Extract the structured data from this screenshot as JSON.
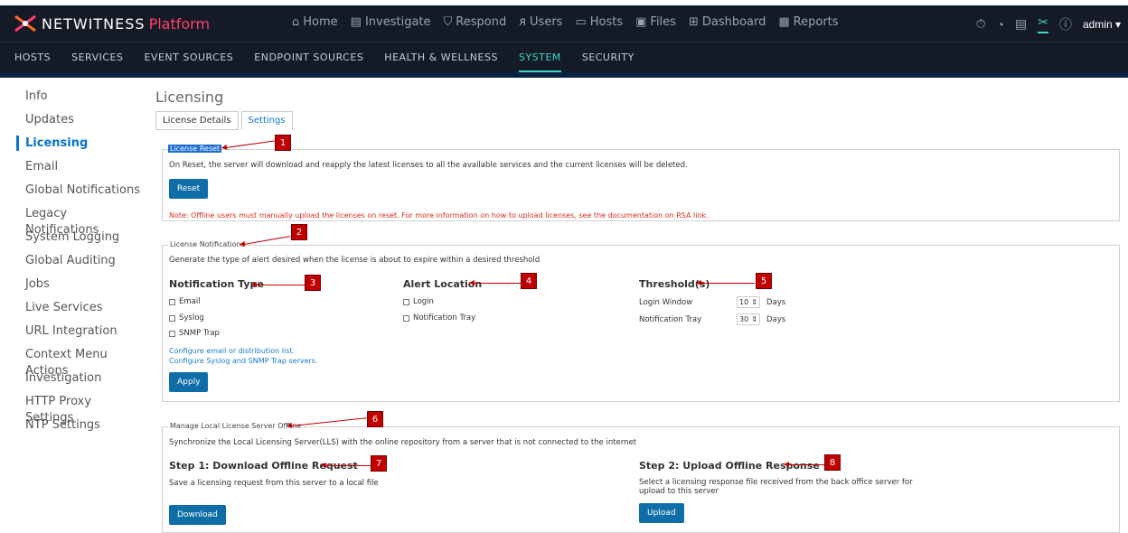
{
  "brand": {
    "name": "NETWITNESS",
    "product": "Platform"
  },
  "main_nav": [
    {
      "icon": "home-icon",
      "glyph": "⌂",
      "label": "Home"
    },
    {
      "icon": "investigate-icon",
      "glyph": "▤",
      "label": "Investigate"
    },
    {
      "icon": "respond-icon",
      "glyph": "⛉",
      "label": "Respond"
    },
    {
      "icon": "users-icon",
      "glyph": "ᴙ",
      "label": "Users"
    },
    {
      "icon": "hosts-icon",
      "glyph": "▭",
      "label": "Hosts"
    },
    {
      "icon": "files-icon",
      "glyph": "▣",
      "label": "Files"
    },
    {
      "icon": "dashboard-icon",
      "glyph": "⊞",
      "label": "Dashboard"
    },
    {
      "icon": "reports-icon",
      "glyph": "▦",
      "label": "Reports"
    }
  ],
  "user": {
    "name": "admin"
  },
  "sub_nav": [
    "HOSTS",
    "SERVICES",
    "EVENT SOURCES",
    "ENDPOINT SOURCES",
    "HEALTH & WELLNESS",
    "SYSTEM",
    "SECURITY"
  ],
  "sidebar": [
    "Info",
    "Updates",
    "Licensing",
    "Email",
    "Global Notifications",
    "Legacy Notifications",
    "System Logging",
    "Global Auditing",
    "Jobs",
    "Live Services",
    "URL Integration",
    "Context Menu Actions",
    "Investigation",
    "HTTP Proxy Settings",
    "NTP Settings"
  ],
  "page": {
    "title": "Licensing",
    "tabs": [
      "License Details",
      "Settings"
    ]
  },
  "license_reset": {
    "legend": "License Reset",
    "description": "On Reset, the server will download and reapply the latest licenses to all the available services and the current licenses will be deleted.",
    "button": "Reset",
    "note": "Note: Offline users must manually upload the licenses on reset. For more information on how to upload licenses, see the documentation on RSA link."
  },
  "license_notifications": {
    "legend": "License Notifications",
    "description": "Generate the type of alert desired when the license is about to expire within a desired threshold",
    "notification_type": {
      "heading": "Notification Type",
      "options": [
        "Email",
        "Syslog",
        "SNMP Trap"
      ]
    },
    "alert_location": {
      "heading": "Alert Location",
      "options": [
        "Login",
        "Notification Tray"
      ]
    },
    "thresholds": {
      "heading": "Threshold(s)",
      "rows": [
        {
          "label": "Login Window",
          "value": "10",
          "unit": "Days"
        },
        {
          "label": "Notification Tray",
          "value": "30",
          "unit": "Days"
        }
      ]
    },
    "link1": "Configure email or distribution list.",
    "link2": "Configure Syslog and SNMP Trap servers.",
    "button": "Apply"
  },
  "offline": {
    "legend": "Manage Local License Server Offline",
    "description": "Synchronize the Local Licensing Server(LLS) with the online repository from a server that is not connected to the internet",
    "step1": {
      "heading": "Step 1: Download Offline Request",
      "text": "Save a licensing request from this server to a local file",
      "button": "Download"
    },
    "step2": {
      "heading": "Step 2: Upload Offline Response",
      "text": "Select a licensing response file received from the back office server for upload to this server",
      "button": "Upload"
    }
  },
  "callouts": [
    "1",
    "2",
    "3",
    "4",
    "5",
    "6",
    "7",
    "8"
  ],
  "colors": {
    "accent": "#3dd6c8",
    "primary": "#0f6ea8",
    "callout": "#c00000",
    "brand_pink": "#ff3e6c"
  }
}
